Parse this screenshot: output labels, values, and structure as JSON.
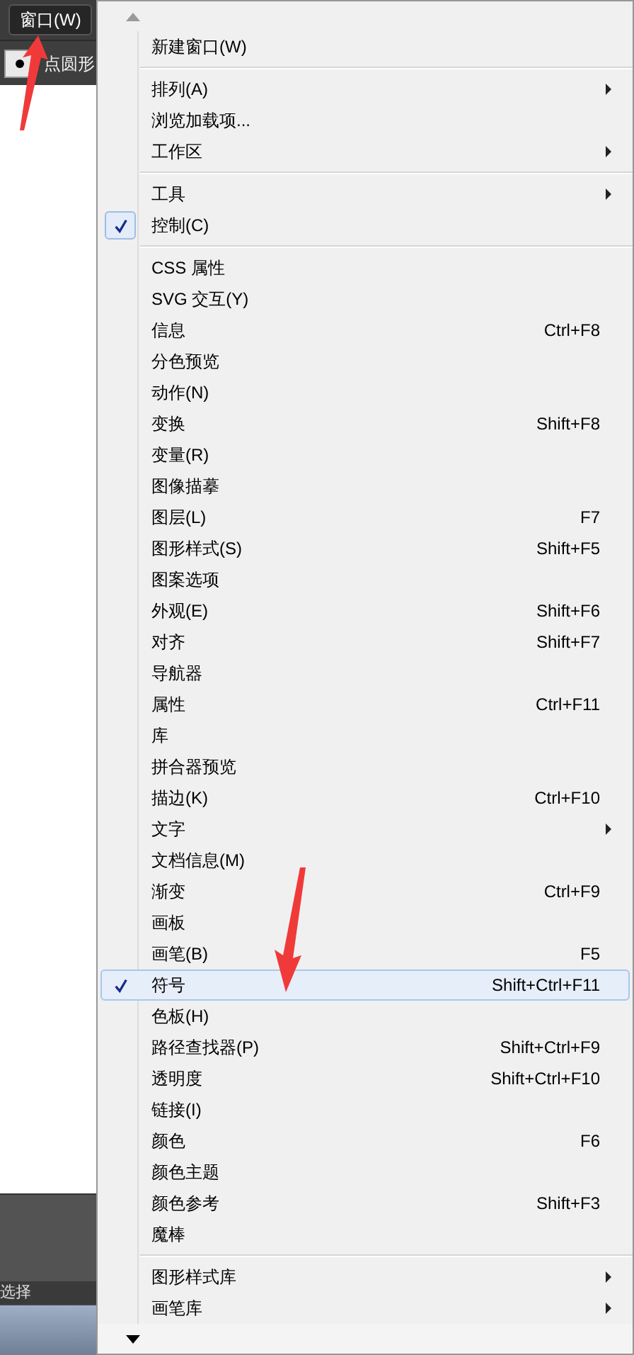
{
  "menubar": {
    "label": "窗口(W)",
    "selected": true
  },
  "control_bar": {
    "option_label": "点圆形"
  },
  "status_label": "选择",
  "menu": {
    "groups": [
      {
        "items": [
          {
            "label": "新建窗口(W)",
            "checked": false,
            "submenu": false,
            "selected": false
          }
        ]
      },
      {
        "items": [
          {
            "label": "排列(A)",
            "checked": false,
            "submenu": true,
            "selected": false
          },
          {
            "label": "浏览加载项...",
            "checked": false,
            "submenu": false,
            "selected": false
          },
          {
            "label": "工作区",
            "checked": false,
            "submenu": true,
            "selected": false
          }
        ]
      },
      {
        "items": [
          {
            "label": "工具",
            "checked": false,
            "submenu": true,
            "selected": false
          },
          {
            "label": "控制(C)",
            "checked": true,
            "submenu": false,
            "selected": false
          }
        ]
      },
      {
        "items": [
          {
            "label": "CSS 属性",
            "checked": false,
            "submenu": false,
            "selected": false
          },
          {
            "label": "SVG 交互(Y)",
            "checked": false,
            "submenu": false,
            "selected": false
          },
          {
            "label": "信息",
            "shortcut": "Ctrl+F8",
            "checked": false,
            "submenu": false,
            "selected": false
          },
          {
            "label": "分色预览",
            "checked": false,
            "submenu": false,
            "selected": false
          },
          {
            "label": "动作(N)",
            "checked": false,
            "submenu": false,
            "selected": false
          },
          {
            "label": "变换",
            "shortcut": "Shift+F8",
            "checked": false,
            "submenu": false,
            "selected": false
          },
          {
            "label": "变量(R)",
            "checked": false,
            "submenu": false,
            "selected": false
          },
          {
            "label": "图像描摹",
            "checked": false,
            "submenu": false,
            "selected": false
          },
          {
            "label": "图层(L)",
            "shortcut": "F7",
            "checked": false,
            "submenu": false,
            "selected": false
          },
          {
            "label": "图形样式(S)",
            "shortcut": "Shift+F5",
            "checked": false,
            "submenu": false,
            "selected": false
          },
          {
            "label": "图案选项",
            "checked": false,
            "submenu": false,
            "selected": false
          },
          {
            "label": "外观(E)",
            "shortcut": "Shift+F6",
            "checked": false,
            "submenu": false,
            "selected": false
          },
          {
            "label": "对齐",
            "shortcut": "Shift+F7",
            "checked": false,
            "submenu": false,
            "selected": false
          },
          {
            "label": "导航器",
            "checked": false,
            "submenu": false,
            "selected": false
          },
          {
            "label": "属性",
            "shortcut": "Ctrl+F11",
            "checked": false,
            "submenu": false,
            "selected": false
          },
          {
            "label": "库",
            "checked": false,
            "submenu": false,
            "selected": false
          },
          {
            "label": "拼合器预览",
            "checked": false,
            "submenu": false,
            "selected": false
          },
          {
            "label": "描边(K)",
            "shortcut": "Ctrl+F10",
            "checked": false,
            "submenu": false,
            "selected": false
          },
          {
            "label": "文字",
            "checked": false,
            "submenu": true,
            "selected": false
          },
          {
            "label": "文档信息(M)",
            "checked": false,
            "submenu": false,
            "selected": false
          },
          {
            "label": "渐变",
            "shortcut": "Ctrl+F9",
            "checked": false,
            "submenu": false,
            "selected": false
          },
          {
            "label": "画板",
            "checked": false,
            "submenu": false,
            "selected": false
          },
          {
            "label": "画笔(B)",
            "shortcut": "F5",
            "checked": false,
            "submenu": false,
            "selected": false
          },
          {
            "label": "符号",
            "shortcut": "Shift+Ctrl+F11",
            "checked": true,
            "submenu": false,
            "selected": true
          },
          {
            "label": "色板(H)",
            "checked": false,
            "submenu": false,
            "selected": false
          },
          {
            "label": "路径查找器(P)",
            "shortcut": "Shift+Ctrl+F9",
            "checked": false,
            "submenu": false,
            "selected": false
          },
          {
            "label": "透明度",
            "shortcut": "Shift+Ctrl+F10",
            "checked": false,
            "submenu": false,
            "selected": false
          },
          {
            "label": "链接(I)",
            "checked": false,
            "submenu": false,
            "selected": false
          },
          {
            "label": "颜色",
            "shortcut": "F6",
            "checked": false,
            "submenu": false,
            "selected": false
          },
          {
            "label": "颜色主题",
            "checked": false,
            "submenu": false,
            "selected": false
          },
          {
            "label": "颜色参考",
            "shortcut": "Shift+F3",
            "checked": false,
            "submenu": false,
            "selected": false
          },
          {
            "label": "魔棒",
            "checked": false,
            "submenu": false,
            "selected": false
          }
        ]
      },
      {
        "items": [
          {
            "label": "图形样式库",
            "checked": false,
            "submenu": true,
            "selected": false
          },
          {
            "label": "画笔库",
            "checked": false,
            "submenu": true,
            "selected": false
          }
        ]
      }
    ]
  }
}
